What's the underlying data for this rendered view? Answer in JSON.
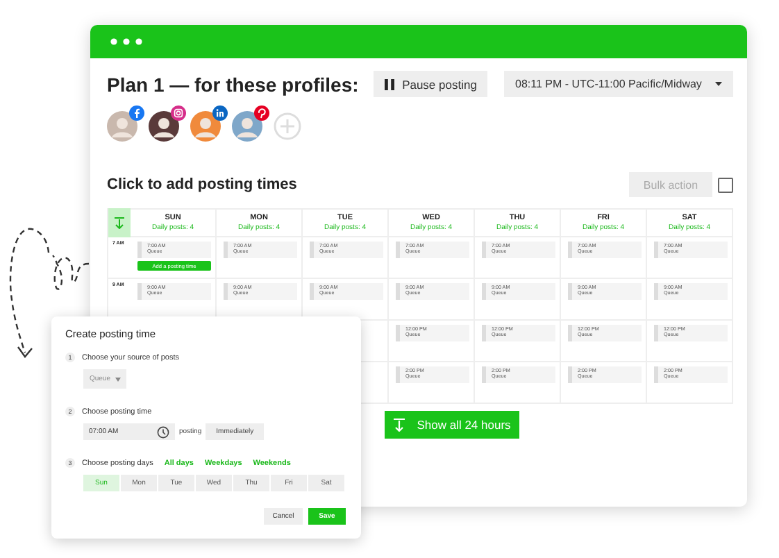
{
  "plan": {
    "title": "Plan 1 — for these profiles:",
    "pause_button": "Pause posting",
    "timezone": "08:11 PM - UTC-11:00 Pacific/Midway"
  },
  "profiles": [
    {
      "kind": "facebook"
    },
    {
      "kind": "instagram"
    },
    {
      "kind": "linkedin"
    },
    {
      "kind": "pinterest"
    }
  ],
  "schedule": {
    "heading": "Click to add posting times",
    "bulk_action": "Bulk action",
    "bulk_checked": false,
    "days": [
      {
        "name": "SUN",
        "daily": "Daily posts: 4"
      },
      {
        "name": "MON",
        "daily": "Daily posts: 4"
      },
      {
        "name": "TUE",
        "daily": "Daily posts: 4"
      },
      {
        "name": "WED",
        "daily": "Daily posts: 4"
      },
      {
        "name": "THU",
        "daily": "Daily posts: 4"
      },
      {
        "name": "FRI",
        "daily": "Daily posts: 4"
      },
      {
        "name": "SAT",
        "daily": "Daily posts: 4"
      }
    ],
    "rows": [
      {
        "time": "7 AM",
        "slots": [
          {
            "time": "7:00 AM",
            "source": "Queue"
          },
          {
            "time": "7:00 AM",
            "source": "Queue"
          },
          {
            "time": "7:00 AM",
            "source": "Queue"
          },
          {
            "time": "7:00 AM",
            "source": "Queue"
          },
          {
            "time": "7:00 AM",
            "source": "Queue"
          },
          {
            "time": "7:00 AM",
            "source": "Queue"
          },
          {
            "time": "7:00 AM",
            "source": "Queue"
          }
        ]
      },
      {
        "time": "9 AM",
        "slots": [
          {
            "time": "9:00 AM",
            "source": "Queue"
          },
          {
            "time": "9:00 AM",
            "source": "Queue"
          },
          {
            "time": "9:00 AM",
            "source": "Queue"
          },
          {
            "time": "9:00 AM",
            "source": "Queue"
          },
          {
            "time": "9:00 AM",
            "source": "Queue"
          },
          {
            "time": "9:00 AM",
            "source": "Queue"
          },
          {
            "time": "9:00 AM",
            "source": "Queue"
          }
        ]
      },
      {
        "slots": [
          {
            "time": "12:00 PM",
            "source": "Queue"
          },
          {
            "time": "12:00 PM",
            "source": "Queue"
          },
          {
            "time": "12:00 PM",
            "source": "Queue"
          },
          {
            "time": "12:00 PM",
            "source": "Queue"
          }
        ]
      },
      {
        "slots": [
          {
            "time": "2:00 PM",
            "source": "Queue"
          },
          {
            "time": "2:00 PM",
            "source": "Queue"
          },
          {
            "time": "2:00 PM",
            "source": "Queue"
          },
          {
            "time": "2:00 PM",
            "source": "Queue"
          }
        ]
      }
    ],
    "add_button": "Add a posting time",
    "show_all": "Show all 24 hours"
  },
  "dialog": {
    "title": "Create posting time",
    "steps": [
      {
        "number": "1",
        "label": "Choose your source of posts"
      },
      {
        "number": "2",
        "label": "Choose posting time"
      },
      {
        "number": "3",
        "label": "Choose posting days"
      }
    ],
    "source": "Queue",
    "time_value": "07:00 AM",
    "posting_label": "posting",
    "posting_mode": "Immediately",
    "day_links": [
      "All days",
      "Weekdays",
      "Weekends"
    ],
    "days": [
      {
        "label": "Sun",
        "selected": true
      },
      {
        "label": "Mon",
        "selected": false
      },
      {
        "label": "Tue",
        "selected": false
      },
      {
        "label": "Wed",
        "selected": false
      },
      {
        "label": "Thu",
        "selected": false
      },
      {
        "label": "Fri",
        "selected": false
      },
      {
        "label": "Sat",
        "selected": false
      }
    ],
    "cancel": "Cancel",
    "save": "Save"
  }
}
